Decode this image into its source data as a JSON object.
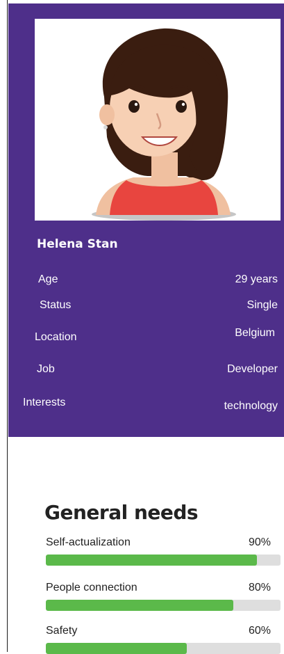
{
  "profile": {
    "name": "Helena Stan",
    "fields": [
      {
        "label": "Age",
        "value": "29 years"
      },
      {
        "label": "Status",
        "value": "Single"
      },
      {
        "label": "Location",
        "value": "Belgium"
      },
      {
        "label": "Job",
        "value": "Developer"
      },
      {
        "label": "Interests",
        "value": "technology"
      }
    ],
    "colors": {
      "card": "#4e2f8a",
      "text": "#ffffff"
    },
    "avatar_icon": "woman-avatar-icon"
  },
  "needs": {
    "title": "General needs",
    "items": [
      {
        "label": "Self-actualization",
        "percent_label": "90%",
        "percent": 0.9
      },
      {
        "label": "People connection",
        "percent_label": "80%",
        "percent": 0.8
      },
      {
        "label": "Safety",
        "percent_label": "60%",
        "percent": 0.6
      }
    ],
    "colors": {
      "fill": "#5bb94a",
      "track": "#dedede"
    }
  }
}
